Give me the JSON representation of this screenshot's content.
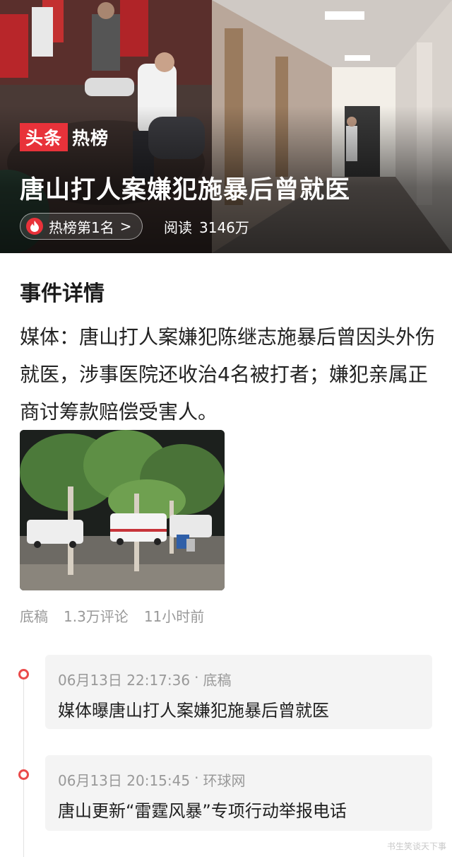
{
  "hero": {
    "brand_primary": "头条",
    "brand_secondary": "热榜",
    "title": "唐山打人案嫌犯施暴后曾就医",
    "rank_label": "热榜第1名",
    "rank_chevron": ">",
    "read_label": "阅读",
    "read_count": "3146万",
    "icon": "fire-icon",
    "brand_color": "#e8323a"
  },
  "detail": {
    "heading": "事件详情",
    "summary": "媒体：唐山打人案嫌犯陈继志施暴后曾因头外伤就医，涉事医院还收治4名被打者；嫌犯亲属正商讨筹款赔偿受害人。"
  },
  "meta": {
    "source": "底稿",
    "comments": "1.3万评论",
    "time": "11小时前"
  },
  "timeline": [
    {
      "datetime": "06月13日 22:17:36",
      "separator": "·",
      "source": "底稿",
      "text": "媒体曝唐山打人案嫌犯施暴后曾就医"
    },
    {
      "datetime": "06月13日 20:15:45",
      "separator": "·",
      "source": "环球网",
      "text": "唐山更新“雷霆风暴”专项行动举报电话"
    }
  ],
  "watermark": "书生笑谈天下事",
  "accent_color": "#ea4b4b"
}
